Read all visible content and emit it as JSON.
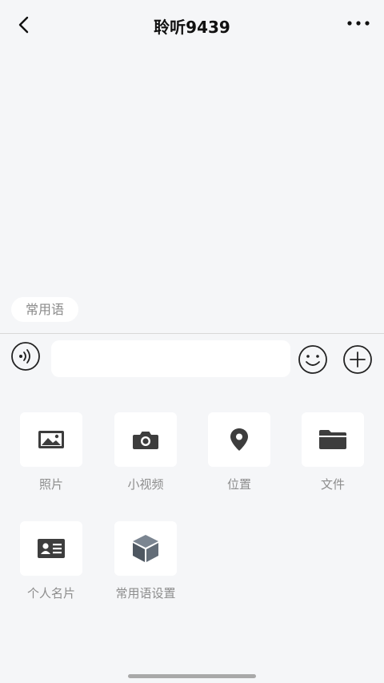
{
  "header": {
    "title": "聆听9439",
    "back_icon": "chevron-left-icon",
    "more_icon": "more-dots-icon"
  },
  "quick_phrase": {
    "label": "常用语"
  },
  "composer": {
    "placeholder": "",
    "voice_icon": "voice-icon",
    "emoji_icon": "emoji-icon",
    "plus_icon": "plus-icon"
  },
  "tools": [
    {
      "label": "照片",
      "icon": "photo-icon"
    },
    {
      "label": "小视频",
      "icon": "camera-icon"
    },
    {
      "label": "位置",
      "icon": "location-pin-icon"
    },
    {
      "label": "文件",
      "icon": "folder-icon"
    },
    {
      "label": "个人名片",
      "icon": "contact-card-icon"
    },
    {
      "label": "常用语设置",
      "icon": "cube-icon"
    }
  ],
  "colors": {
    "background": "#f5f6f8",
    "tile": "#ffffff",
    "icon": "#3d3d3d",
    "label": "#8d8d8d"
  }
}
